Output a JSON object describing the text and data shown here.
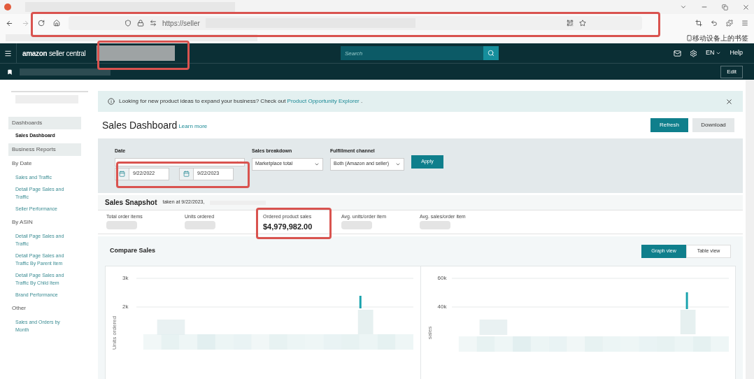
{
  "browser": {
    "url": "https://seller",
    "bookmark": "移动设备上的书签"
  },
  "nav": {
    "logo_primary": "amazon",
    "logo_secondary": "seller central",
    "search_placeholder": "Search",
    "language": "EN",
    "help": "Help",
    "edit": "Edit"
  },
  "sidebar": [
    {
      "label": "Dashboards",
      "kind": "section"
    },
    {
      "label": "Sales Dashboard",
      "kind": "link",
      "selected": true
    },
    {
      "label": "Business Reports",
      "kind": "section"
    },
    {
      "label": "By Date",
      "kind": "group"
    },
    {
      "label": "Sales and Traffic",
      "kind": "link",
      "selected": false
    },
    {
      "label": "Detail Page Sales and Traffic",
      "kind": "link",
      "selected": false
    },
    {
      "label": "Seller Performance",
      "kind": "link",
      "selected": false
    },
    {
      "label": "By ASIN",
      "kind": "group"
    },
    {
      "label": "Detail Page Sales and Traffic",
      "kind": "link",
      "selected": false
    },
    {
      "label": "Detail Page Sales and Traffic By Parent Item",
      "kind": "link",
      "selected": false
    },
    {
      "label": "Detail Page Sales and Traffic By Child Item",
      "kind": "link",
      "selected": false
    },
    {
      "label": "Brand Performance",
      "kind": "link",
      "selected": false
    },
    {
      "label": "Other",
      "kind": "group"
    },
    {
      "label": "Sales and Orders by Month",
      "kind": "link",
      "selected": false
    }
  ],
  "banner": {
    "text": "Looking for new product ideas to expand your business? Check out",
    "link": "Product Opportunity Explorer",
    "suffix": "."
  },
  "page": {
    "title": "Sales Dashboard",
    "learn_more": "Learn more",
    "buttons": [
      {
        "label": "Refresh",
        "kind": "primary"
      },
      {
        "label": "Download",
        "kind": "secondary"
      }
    ]
  },
  "filters": {
    "date_label": "Date",
    "start_date": "9/22/2022",
    "end_date": "9/22/2023",
    "breakdown_label": "Sales breakdown",
    "breakdown_value": "Marketplace total",
    "channel_label": "Fulfillment channel",
    "channel_value": "Both (Amazon and seller)",
    "apply": "Apply"
  },
  "snapshot": {
    "title": "Sales Snapshot",
    "taken_at": "taken at 9/22/2023,",
    "metrics": [
      {
        "label": "Total order items"
      },
      {
        "label": "Units ordered"
      },
      {
        "label": "Ordered product sales",
        "value": "$4,979,982.00"
      },
      {
        "label": "Avg. units/order item"
      },
      {
        "label": "Avg. sales/order item"
      }
    ]
  },
  "compare": {
    "title": "Compare Sales",
    "views": [
      {
        "label": "Graph view",
        "selected": true
      },
      {
        "label": "Table view",
        "selected": false
      }
    ],
    "charts": [
      {
        "ylabel": "Units ordered",
        "ticks": [
          "3k",
          "2k"
        ]
      },
      {
        "ylabel": "sales",
        "ticks": [
          "60k",
          "40k"
        ]
      }
    ]
  }
}
